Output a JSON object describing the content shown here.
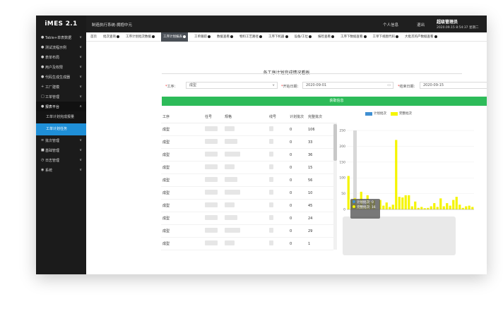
{
  "app": {
    "logo": "iMES 2.1"
  },
  "topbar": {
    "system_title": "制造执行系统-拥抱中元",
    "personal_info": "个人信息",
    "logout": "退出",
    "user": "超级管理员",
    "datetime": "2020.09.15 8:54:37 星期二"
  },
  "sidebar": {
    "items": [
      {
        "icon": "●",
        "label": "Table+单表数据",
        "chevron": "∨"
      },
      {
        "icon": "●",
        "label": "测试流程示例",
        "chevron": "∨"
      },
      {
        "icon": "●",
        "label": "表单布局",
        "chevron": "∨"
      },
      {
        "icon": "●",
        "label": "用户及权限",
        "chevron": "∨"
      },
      {
        "icon": "●",
        "label": "代码生成生成器",
        "chevron": "∨"
      },
      {
        "icon": "+",
        "label": "工厂建模",
        "chevron": "∨"
      },
      {
        "icon": "□",
        "label": "工单管理",
        "chevron": "∨"
      },
      {
        "icon": "●",
        "label": "报表平台",
        "chevron": "∧"
      }
    ],
    "sub_items": [
      {
        "label": "工单计划完成报量"
      },
      {
        "label": "工单计划任务"
      }
    ],
    "items_after": [
      {
        "icon": "≡",
        "label": "批次管理",
        "chevron": "∨"
      },
      {
        "icon": "■",
        "label": "基础管理",
        "chevron": "∨"
      },
      {
        "icon": "◷",
        "label": "日志管理",
        "chevron": "∨"
      },
      {
        "icon": "◉",
        "label": "系统",
        "chevron": "∨"
      }
    ]
  },
  "tabs": [
    {
      "label": "首页"
    },
    {
      "label": "批次查询"
    },
    {
      "label": "工序计划批次数据"
    },
    {
      "label": "工序计划报表"
    },
    {
      "label": "工单跟踪"
    },
    {
      "label": "数据查看"
    },
    {
      "label": "物料工艺路径"
    },
    {
      "label": "工序下机器"
    },
    {
      "label": "设备/工位"
    },
    {
      "label": "报检查看"
    },
    {
      "label": "工序下数据查看"
    },
    {
      "label": "工单下视图代码"
    },
    {
      "label": "大批次的产数据查看"
    }
  ],
  "report": {
    "title": "各工序计划完成情况看板",
    "process_label": "工序：",
    "process_value": "成型",
    "start_label": "开始日期：",
    "start_value": "2020-09-01",
    "end_label": "结束日期：",
    "end_value": "2020-09-15",
    "query_button": "获取信息"
  },
  "table": {
    "headers": [
      "工序",
      "任号",
      "规格",
      "线号",
      "计划批次",
      "完整批次"
    ],
    "rows": [
      {
        "process": "成型",
        "plan": "0",
        "done": "106"
      },
      {
        "process": "成型",
        "plan": "0",
        "done": "33"
      },
      {
        "process": "成型",
        "plan": "0",
        "done": "36"
      },
      {
        "process": "成型",
        "plan": "0",
        "done": "15"
      },
      {
        "process": "成型",
        "plan": "0",
        "done": "56"
      },
      {
        "process": "成型",
        "plan": "0",
        "done": "10"
      },
      {
        "process": "成型",
        "plan": "0",
        "done": "45"
      },
      {
        "process": "成型",
        "plan": "0",
        "done": "24"
      },
      {
        "process": "成型",
        "plan": "0",
        "done": "29"
      },
      {
        "process": "成型",
        "plan": "0",
        "done": "1"
      }
    ]
  },
  "chart_data": {
    "type": "bar",
    "legend": [
      {
        "name": "计划批次",
        "color": "#3f8fd2"
      },
      {
        "name": "完整批次",
        "color": "#f5f500"
      }
    ],
    "ylim": [
      0,
      250
    ],
    "yticks": [
      0,
      50,
      100,
      150,
      200,
      250
    ],
    "series": [
      {
        "name": "计划批次",
        "values": [
          0,
          0,
          0,
          0,
          0,
          0,
          0,
          0,
          0,
          0,
          0,
          0,
          0,
          0,
          0,
          0,
          0,
          0,
          0,
          0,
          0,
          0,
          0,
          0,
          0,
          0,
          0,
          0,
          0,
          0,
          0,
          0,
          0,
          0,
          0,
          0,
          0,
          0,
          0,
          0
        ]
      },
      {
        "name": "完整批次",
        "values": [
          106,
          30,
          36,
          15,
          56,
          10,
          45,
          24,
          29,
          1,
          30,
          12,
          22,
          8,
          15,
          220,
          40,
          38,
          45,
          45,
          10,
          25,
          5,
          8,
          4,
          5,
          10,
          20,
          8,
          35,
          10,
          20,
          12,
          30,
          40,
          15,
          5,
          10,
          12,
          8
        ]
      }
    ],
    "tooltip": {
      "plan_label": "计划批次: 0",
      "done_label": "完整批次: 16"
    }
  }
}
